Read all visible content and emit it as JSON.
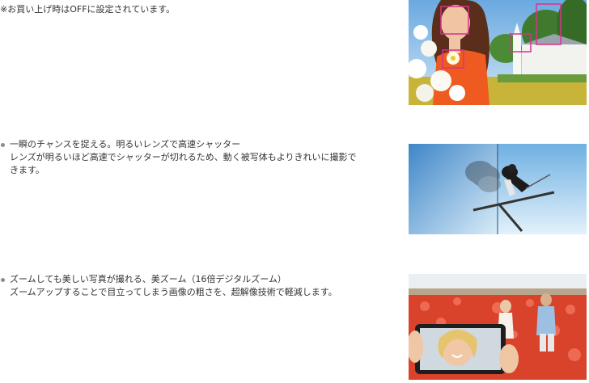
{
  "note": "※お買い上げ時はOFFに設定されています。",
  "features": [
    {
      "heading": "一瞬のチャンスを捉える。明るいレンズで高速シャッター",
      "body_line1": "レンズが明るいほど高速でシャッターが切れるため、動く被写体もよりきれいに撮影で",
      "body_line2": "きます。"
    },
    {
      "heading": "ズームしても美しい写真が撮れる、美ズーム（16倍デジタルズーム）",
      "body": "ズームアップすることで目立ってしまう画像の粗さを、超解像技術で軽減します。"
    }
  ],
  "colors": {
    "text": "#333333",
    "face_detection_frame": "#d6338c",
    "sky": "#5f9fd8"
  }
}
